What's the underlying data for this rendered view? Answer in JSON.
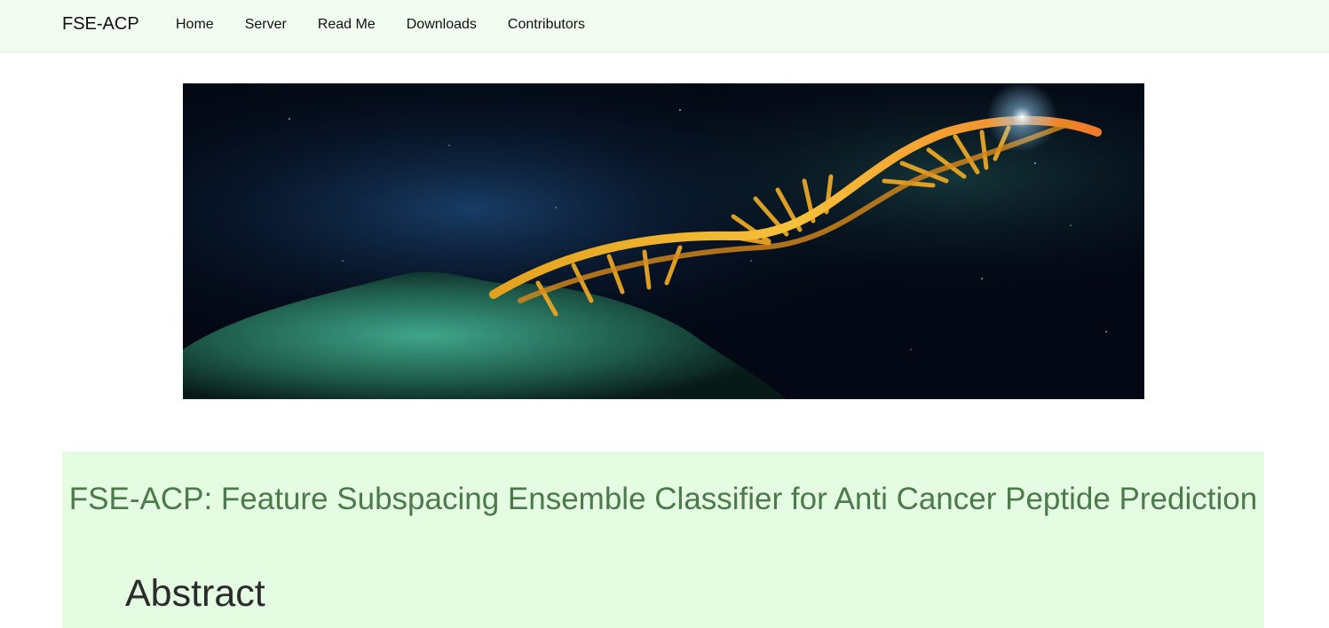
{
  "navbar": {
    "brand": "FSE-ACP",
    "links": [
      {
        "label": "Home"
      },
      {
        "label": "Server"
      },
      {
        "label": "Read Me"
      },
      {
        "label": "Downloads"
      },
      {
        "label": "Contributors"
      }
    ]
  },
  "hero": {
    "image": "dna-helix-banner"
  },
  "main": {
    "title": "FSE-ACP: Feature Subspacing Ensemble Classifier for Anti Cancer Peptide Prediction",
    "abstract_heading": "Abstract"
  },
  "colors": {
    "navbar_bg": "#f3fcf1",
    "content_bg": "#e4fce2",
    "title_color": "#4d7a4a"
  }
}
